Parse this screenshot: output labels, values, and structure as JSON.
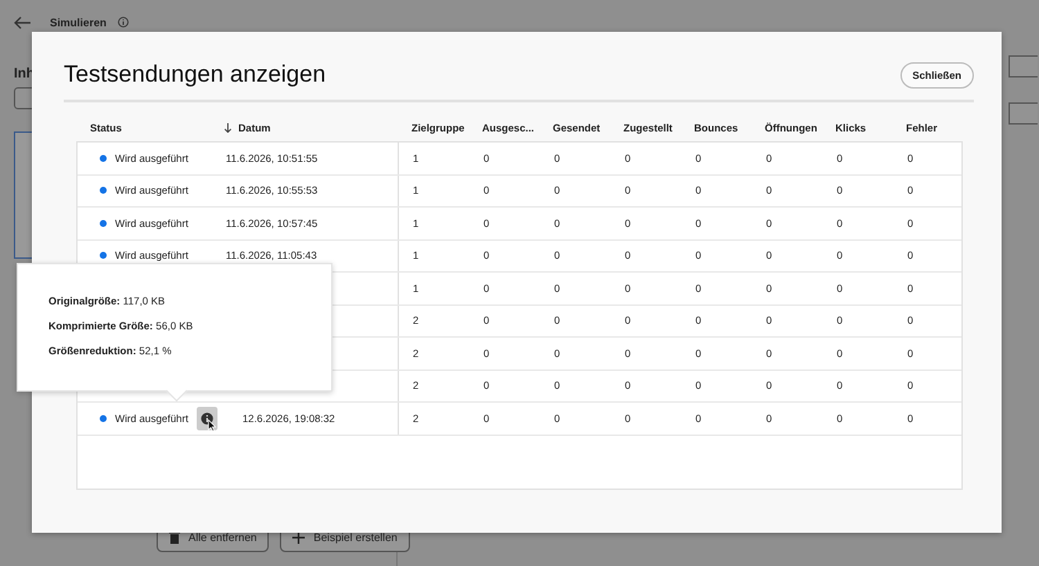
{
  "page": {
    "title": "Simulieren",
    "section_heading": "Inh",
    "buttons": [
      {
        "label": "Alle entfernen"
      },
      {
        "label": "Beispiel erstellen"
      }
    ]
  },
  "dialog": {
    "title": "Testsendungen anzeigen",
    "close_button": "Schließen",
    "table": {
      "columns": [
        {
          "label": "Status",
          "sorted": false
        },
        {
          "label": "Datum",
          "sorted": true
        },
        {
          "label": "Zielgruppe",
          "sorted": false
        },
        {
          "label": "Ausgesc...",
          "sorted": false
        },
        {
          "label": "Gesendet",
          "sorted": false
        },
        {
          "label": "Zugestellt",
          "sorted": false
        },
        {
          "label": "Bounces",
          "sorted": false
        },
        {
          "label": "Öffnungen",
          "sorted": false
        },
        {
          "label": "Klicks",
          "sorted": false
        },
        {
          "label": "Fehler",
          "sorted": false
        }
      ],
      "rows": [
        {
          "info": false,
          "cells": [
            "Wird ausgeführt",
            "11.6.2026, 10:51:55",
            "1",
            "0",
            "0",
            "0",
            "0",
            "0",
            "0",
            "0"
          ]
        },
        {
          "info": false,
          "cells": [
            "Wird ausgeführt",
            "11.6.2026, 10:55:53",
            "1",
            "0",
            "0",
            "0",
            "0",
            "0",
            "0",
            "0"
          ]
        },
        {
          "info": false,
          "cells": [
            "Wird ausgeführt",
            "11.6.2026, 10:57:45",
            "1",
            "0",
            "0",
            "0",
            "0",
            "0",
            "0",
            "0"
          ]
        },
        {
          "info": false,
          "cells": [
            "Wird ausgeführt",
            "11.6.2026, 11:05:43",
            "1",
            "0",
            "0",
            "0",
            "0",
            "0",
            "0",
            "0"
          ]
        },
        {
          "info": false,
          "cells": [
            "",
            "",
            "1",
            "0",
            "0",
            "0",
            "0",
            "0",
            "0",
            "0"
          ]
        },
        {
          "info": false,
          "cells": [
            "",
            "",
            "2",
            "0",
            "0",
            "0",
            "0",
            "0",
            "0",
            "0"
          ]
        },
        {
          "info": false,
          "cells": [
            "",
            "",
            "2",
            "0",
            "0",
            "0",
            "0",
            "0",
            "0",
            "0"
          ]
        },
        {
          "info": false,
          "cells": [
            "",
            "",
            "2",
            "0",
            "0",
            "0",
            "0",
            "0",
            "0",
            "0"
          ]
        },
        {
          "info": true,
          "cells": [
            "Wird ausgeführt",
            "12.6.2026, 19:08:32",
            "2",
            "0",
            "0",
            "0",
            "0",
            "0",
            "0",
            "0"
          ]
        }
      ]
    }
  },
  "tooltip": {
    "lines": [
      {
        "label": "Originalgröße:",
        "value": "117,0 KB"
      },
      {
        "label": "Komprimierte Größe:",
        "value": "56,0 KB"
      },
      {
        "label": "Größenreduktion:",
        "value": "52,1 %"
      }
    ]
  }
}
